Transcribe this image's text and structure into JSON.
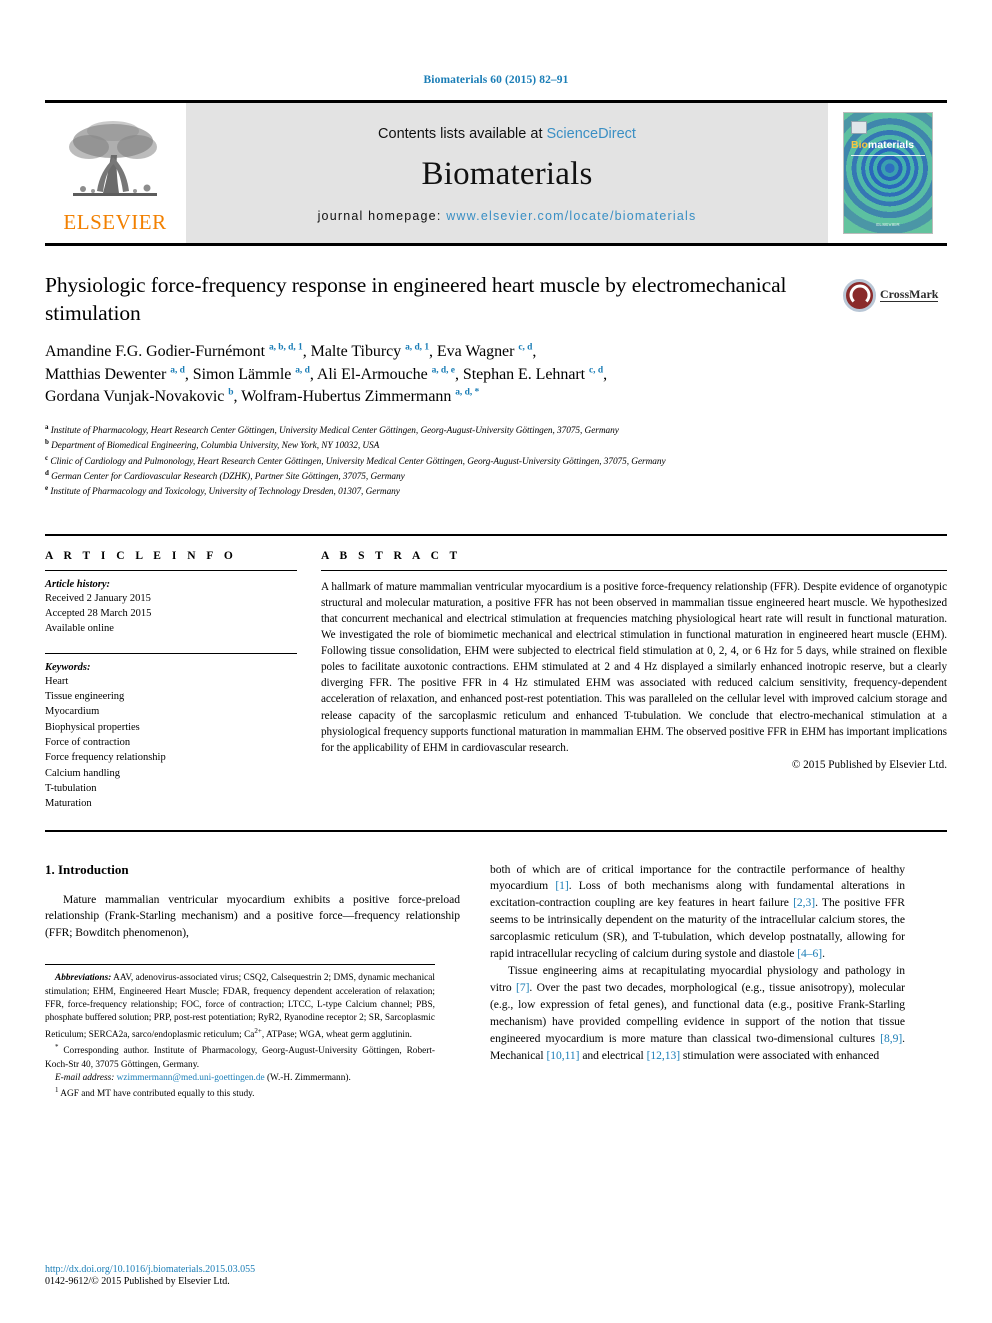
{
  "running_head": "Biomaterials 60 (2015) 82–91",
  "masthead": {
    "publisher_name": "ELSEVIER",
    "contents_prefix": "Contents lists available at ",
    "contents_link": "ScienceDirect",
    "journal_name": "Biomaterials",
    "homepage_label": "journal homepage: ",
    "homepage_link": "www.elsevier.com/locate/biomaterials",
    "cover_title_bio": "Bio",
    "cover_title_rest": "materials",
    "cover_footer": "ELSEVIER"
  },
  "article": {
    "title": "Physiologic force-frequency response in engineered heart muscle by electromechanical stimulation",
    "crossmark_label": "CrossMark",
    "authors_html": "Amandine F.G. Godier-Furnémont <sup>a, b, d, 1</sup>, Malte Tiburcy <sup>a, d, 1</sup>, Eva Wagner <sup>c, d</sup>,<br>Matthias Dewenter <sup>a, d</sup>, Simon Lämmle <sup>a, d</sup>, Ali El-Armouche <sup>a, d, e</sup>, Stephan E. Lehnart <sup>c, d</sup>,<br>Gordana Vunjak-Novakovic <sup>b</sup>, Wolfram-Hubertus Zimmermann <sup>a, d, *</sup>",
    "affiliations": [
      {
        "marker": "a",
        "text": "Institute of Pharmacology, Heart Research Center Göttingen, University Medical Center Göttingen, Georg-August-University Göttingen, 37075, Germany"
      },
      {
        "marker": "b",
        "text": "Department of Biomedical Engineering, Columbia University, New York, NY 10032, USA"
      },
      {
        "marker": "c",
        "text": "Clinic of Cardiology and Pulmonology, Heart Research Center Göttingen, University Medical Center Göttingen, Georg-August-University Göttingen, 37075, Germany"
      },
      {
        "marker": "d",
        "text": "German Center for Cardiovascular Research (DZHK), Partner Site Göttingen, 37075, Germany"
      },
      {
        "marker": "e",
        "text": "Institute of Pharmacology and Toxicology, University of Technology Dresden, 01307, Germany"
      }
    ]
  },
  "article_info": {
    "heading": "A R T I C L E   I N F O",
    "history_label": "Article history:",
    "history": [
      "Received 2 January 2015",
      "Accepted 28 March 2015",
      "Available online"
    ],
    "keywords_label": "Keywords:",
    "keywords": [
      "Heart",
      "Tissue engineering",
      "Myocardium",
      "Biophysical properties",
      "Force of contraction",
      "Force frequency relationship",
      "Calcium handling",
      "T-tubulation",
      "Maturation"
    ]
  },
  "abstract": {
    "heading": "A B S T R A C T",
    "text": "A hallmark of mature mammalian ventricular myocardium is a positive force-frequency relationship (FFR). Despite evidence of organotypic structural and molecular maturation, a positive FFR has not been observed in mammalian tissue engineered heart muscle. We hypothesized that concurrent mechanical and electrical stimulation at frequencies matching physiological heart rate will result in functional maturation. We investigated the role of biomimetic mechanical and electrical stimulation in functional maturation in engineered heart muscle (EHM). Following tissue consolidation, EHM were subjected to electrical field stimulation at 0, 2, 4, or 6 Hz for 5 days, while strained on flexible poles to facilitate auxotonic contractions. EHM stimulated at 2 and 4 Hz displayed a similarly enhanced inotropic reserve, but a clearly diverging FFR. The positive FFR in 4 Hz stimulated EHM was associated with reduced calcium sensitivity, frequency-dependent acceleration of relaxation, and enhanced post-rest potentiation. This was paralleled on the cellular level with improved calcium storage and release capacity of the sarcoplasmic reticulum and enhanced T-tubulation. We conclude that electro-mechanical stimulation at a physiological frequency supports functional maturation in mammalian EHM. The observed positive FFR in EHM has important implications for the applicability of EHM in cardiovascular research.",
    "copyright": "© 2015 Published by Elsevier Ltd."
  },
  "body": {
    "section_number_title": "1.  Introduction",
    "left_paragraph_1": "Mature mammalian ventricular myocardium exhibits a positive force-preload relationship (Frank-Starling mechanism) and a positive force—frequency relationship (FFR; Bowditch phenomenon),",
    "right_paragraph_1_pre": "both of which are of critical importance for the contractile performance of healthy myocardium ",
    "right_ref_1": "[1]",
    "right_paragraph_1_mid": ". Loss of both mechanisms along with fundamental alterations in excitation-contraction coupling are key features in heart failure ",
    "right_ref_2": "[2,3]",
    "right_paragraph_1_mid2": ". The positive FFR seems to be intrinsically dependent on the maturity of the intracellular calcium stores, the sarcoplasmic reticulum (SR), and T-tubulation, which develop postnatally, allowing for rapid intracellular recycling of calcium during systole and diastole ",
    "right_ref_3": "[4–6]",
    "right_paragraph_1_end": ".",
    "right_paragraph_2_pre": "Tissue engineering aims at recapitulating myocardial physiology and pathology in vitro ",
    "right_ref_4": "[7]",
    "right_paragraph_2_mid": ". Over the past two decades, morphological (e.g., tissue anisotropy), molecular (e.g., low expression of fetal genes), and functional data (e.g., positive Frank-Starling mechanism) have provided compelling evidence in support of the notion that tissue engineered myocardium is more mature than classical two-dimensional cultures ",
    "right_ref_5": "[8,9]",
    "right_paragraph_2_mid2": ". Mechanical ",
    "right_ref_6": "[10,11]",
    "right_paragraph_2_mid3": " and electrical ",
    "right_ref_7": "[12,13]",
    "right_paragraph_2_end": " stimulation were associated with enhanced"
  },
  "footnotes": {
    "abbreviations_label": "Abbreviations:",
    "abbreviations_text": " AAV, adenovirus-associated virus; CSQ2, Calsequestrin 2; DMS, dynamic mechanical stimulation; EHM, Engineered Heart Muscle; FDAR, frequency dependent acceleration of relaxation; FFR, force-frequency relationship; FOC, force of contraction; LTCC, L-type Calcium channel; PBS, phosphate buffered solution; PRP, post-rest potentiation; RyR2, Ryanodine receptor 2; SR, Sarcoplasmic Reticulum; SERCA2a, sarco/endoplasmic reticulum; Ca2+, ATPase; WGA, wheat germ agglutinin.",
    "corresponding_marker": "*",
    "corresponding_text": " Corresponding author. Institute of Pharmacology, Georg-August-University Göttingen, Robert-Koch-Str 40, 37075 Göttingen, Germany.",
    "email_label": "E-mail address:",
    "email_link": "wzimmermann@med.uni-goettingen.de",
    "email_suffix": " (W.-H. Zimmermann).",
    "equal_contrib_marker": "1",
    "equal_contrib_text": " AGF and MT have contributed equally to this study."
  },
  "footer": {
    "doi": "http://dx.doi.org/10.1016/j.biomaterials.2015.03.055",
    "issn_line": "0142-9612/© 2015 Published by Elsevier Ltd."
  }
}
